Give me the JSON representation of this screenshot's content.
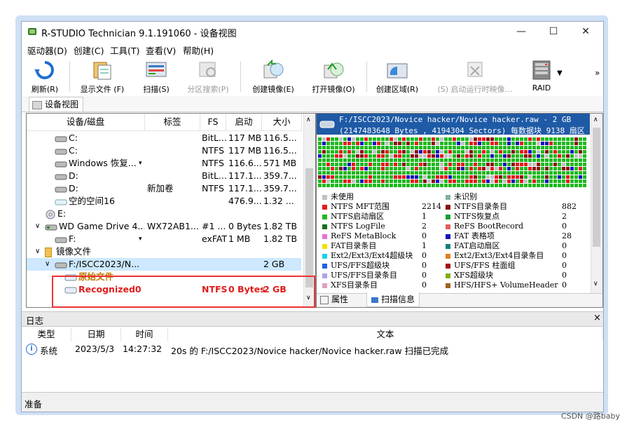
{
  "window": {
    "title": "R-STUDIO Technician 9.1.191060 - 设备视图",
    "buttons": [
      "—",
      "☐",
      "✕"
    ]
  },
  "menu": [
    "驱动器(D)",
    "创建(C)",
    "工具(T)",
    "查看(V)",
    "帮助(H)"
  ],
  "toolbar": [
    {
      "label": "刷新(R)",
      "icon": "refresh-icon",
      "enabled": true
    },
    {
      "label": "显示文件 (F)",
      "icon": "show-files-icon",
      "enabled": true
    },
    {
      "label": "扫描(S)",
      "icon": "scan-icon",
      "enabled": true
    },
    {
      "label": "分区搜索(P)",
      "icon": "partition-search-icon",
      "enabled": false
    },
    {
      "label": "创建镜像(E)",
      "icon": "create-image-icon",
      "enabled": true
    },
    {
      "label": "打开镜像(O)",
      "icon": "open-image-icon",
      "enabled": true
    },
    {
      "label": "创建区域(R)",
      "icon": "create-region-icon",
      "enabled": true
    },
    {
      "label": "(S) 启动运行时映像…",
      "icon": "runtime-image-icon",
      "enabled": false
    },
    {
      "label": "RAID",
      "icon": "raid-icon",
      "enabled": true
    }
  ],
  "toolbar_more": "»",
  "device_tab": "设备视图",
  "table": {
    "columns": [
      "设备/磁盘",
      "标签",
      "FS",
      "启动",
      "大小"
    ],
    "rows": [
      {
        "name": "C:",
        "label": "",
        "fs": "BitL...",
        "start": "117 MB",
        "size": "116.5..."
      },
      {
        "name": "C:",
        "label": "",
        "fs": "NTFS",
        "start": "117 MB",
        "size": "116.5..."
      },
      {
        "name": "Windows 恢复...",
        "label": "",
        "fs": "NTFS",
        "start": "116.6...",
        "size": "571 MB"
      },
      {
        "name": "D:",
        "label": "",
        "fs": "BitL...",
        "start": "117.1...",
        "size": "359.7..."
      },
      {
        "name": "D:",
        "label": "新加卷",
        "fs": "NTFS",
        "start": "117.1...",
        "size": "359.7..."
      },
      {
        "name": "空的空间16",
        "label": "",
        "fs": "",
        "start": "476.9...",
        "size": "1.32 ..."
      },
      {
        "name": "E:",
        "label": "",
        "fs": "",
        "start": "",
        "size": ""
      },
      {
        "name": "WD Game Drive 4...",
        "label": "WX72AB1...",
        "fs": "#1 ...",
        "start": "0 Bytes",
        "size": "1.82 TB"
      },
      {
        "name": "F:",
        "label": "",
        "fs": "exFAT",
        "start": "1 MB",
        "size": "1.82 TB"
      },
      {
        "name": "镜像文件",
        "label": "",
        "fs": "",
        "start": "",
        "size": ""
      },
      {
        "name": "F:/ISCC2023/N...",
        "label": "",
        "fs": "",
        "start": "",
        "size": "2 GB"
      },
      {
        "name": "原始文件",
        "label": "",
        "fs": "",
        "start": "",
        "size": ""
      },
      {
        "name": "Recognized0",
        "label": "",
        "fs": "NTFS",
        "start": "0 Bytes",
        "size": "2 GB"
      }
    ]
  },
  "scan_panel": {
    "line1": "F:/ISCC2023/Novice hacker/Novice hacker.raw - 2 GB",
    "line2": "(2147483648 Bytes , 4194304 Sectors) 每数据块 9138 扇区",
    "legend_left": [
      {
        "label": "未使用",
        "value": "",
        "color": "#c0c0c0"
      },
      {
        "label": "NTFS MFT范围",
        "value": "2214",
        "color": "#e31b1b"
      },
      {
        "label": "NTFS启动扇区",
        "value": "1",
        "color": "#1fb81f"
      },
      {
        "label": "NTFS LogFile",
        "value": "2",
        "color": "#1a6e1a"
      },
      {
        "label": "ReFS MetaBlock",
        "value": "0",
        "color": "#e870d8"
      },
      {
        "label": "FAT目录条目",
        "value": "1",
        "color": "#f0e000"
      },
      {
        "label": "Ext2/Ext3/Ext4超级块",
        "value": "0",
        "color": "#20d0e8"
      },
      {
        "label": "UFS/FFS超级块",
        "value": "0",
        "color": "#2060e8"
      },
      {
        "label": "UFS/FFS目录条目",
        "value": "0",
        "color": "#b0a0e8"
      },
      {
        "label": "XFS目录条目",
        "value": "0",
        "color": "#e0a0c0"
      }
    ],
    "legend_right": [
      {
        "label": "未识别",
        "value": "",
        "color": "#80b0a8"
      },
      {
        "label": "NTFS目录条目",
        "value": "882",
        "color": "#8a1010"
      },
      {
        "label": "NTFS恢复点",
        "value": "2",
        "color": "#10a030"
      },
      {
        "label": "ReFS BootRecord",
        "value": "0",
        "color": "#e06060"
      },
      {
        "label": "FAT 表格项",
        "value": "28",
        "color": "#1010c0"
      },
      {
        "label": "FAT启动扇区",
        "value": "0",
        "color": "#108080"
      },
      {
        "label": "Ext2/Ext3/Ext4目录条目",
        "value": "0",
        "color": "#e08020"
      },
      {
        "label": "UFS/FFS 柱面组",
        "value": "0",
        "color": "#a01010"
      },
      {
        "label": "XFS超级块",
        "value": "0",
        "color": "#80b000"
      },
      {
        "label": "HFS/HFS+ VolumeHeader",
        "value": "0",
        "color": "#a06020"
      }
    ],
    "tabs": [
      "属性",
      "扫描信息"
    ]
  },
  "log": {
    "title": "日志",
    "close": "×",
    "columns": [
      "类型",
      "日期",
      "时间",
      "文本"
    ],
    "rows": [
      {
        "type": "系统",
        "date": "2023/5/3",
        "time": "14:27:32",
        "text": "20s 的 F:/ISCC2023/Novice hacker/Novice hacker.raw 扫描已完成"
      }
    ]
  },
  "status": "准备",
  "watermark": "CSDN @路baby",
  "colors": {
    "accent": "#1e5aa6",
    "highlight": "#cde8ff",
    "recognized": "#e31b1b",
    "raw_file": "#c07a00"
  }
}
